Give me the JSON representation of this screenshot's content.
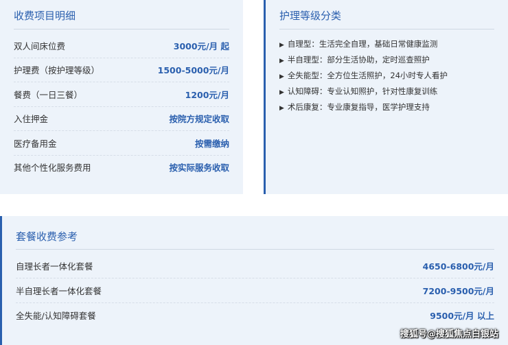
{
  "fees": {
    "title": "收费项目明细",
    "items": [
      {
        "label": "双人间床位费",
        "value": "3000元/月 起"
      },
      {
        "label": "护理费（按护理等级）",
        "value": "1500-5000元/月"
      },
      {
        "label": "餐费（一日三餐）",
        "value": "1200元/月"
      },
      {
        "label": "入住押金",
        "value": "按院方规定收取"
      },
      {
        "label": "医疗备用金",
        "value": "按需缴纳"
      },
      {
        "label": "其他个性化服务费用",
        "value": "按实际服务收取"
      }
    ]
  },
  "care": {
    "title": "护理等级分类",
    "items": [
      {
        "text": "自理型：生活完全自理，基础日常健康监测"
      },
      {
        "text": "半自理型：部分生活协助，定时巡查照护"
      },
      {
        "text": "全失能型：全方位生活照护，24小时专人看护"
      },
      {
        "text": "认知障碍：专业认知照护，针对性康复训练"
      },
      {
        "text": "术后康复：专业康复指导，医学护理支持"
      }
    ],
    "bullet": "▶"
  },
  "packages": {
    "title": "套餐收费参考",
    "items": [
      {
        "label": "自理长者一体化套餐",
        "value": "4650-6800元/月"
      },
      {
        "label": "半自理长者一体化套餐",
        "value": "7200-9500元/月"
      },
      {
        "label": "全失能/认知障碍套餐",
        "value": "9500元/月 以上"
      }
    ]
  },
  "watermark": "搜狐号@搜狐焦点白银站",
  "colors": {
    "accent": "#2a5fae",
    "panel_bg": "#edf3fa",
    "text": "#333333"
  }
}
